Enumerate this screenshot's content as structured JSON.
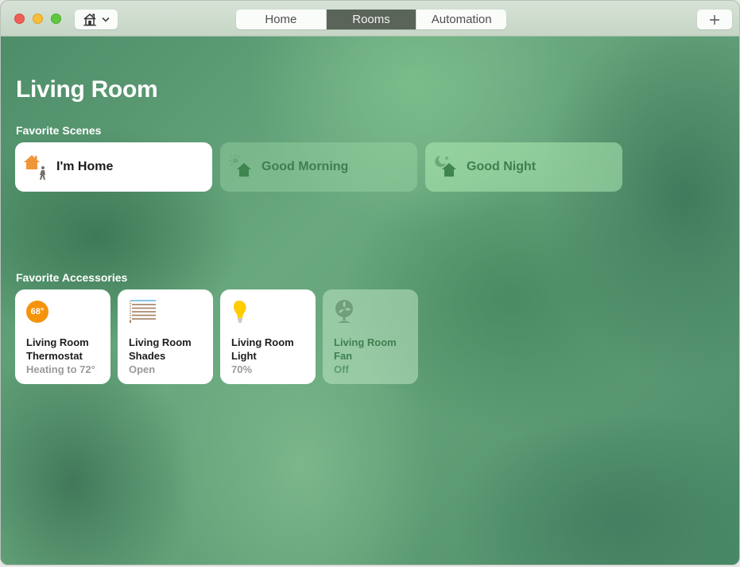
{
  "window": {
    "traffic_lights": [
      "close",
      "minimize",
      "maximize"
    ]
  },
  "toolbar": {
    "home_menu_icon": "house-icon",
    "home_menu_chevron": "chevron-down-icon",
    "tabs": [
      {
        "label": "Home",
        "active": false
      },
      {
        "label": "Rooms",
        "active": true
      },
      {
        "label": "Automation",
        "active": false
      }
    ],
    "add_button_icon": "plus-icon"
  },
  "room": {
    "title": "Living Room"
  },
  "scenes": {
    "label": "Favorite Scenes",
    "items": [
      {
        "label": "I'm Home",
        "icon": "home-arrival-icon",
        "active": true
      },
      {
        "label": "Good Morning",
        "icon": "morning-sun-house-icon",
        "active": false
      },
      {
        "label": "Good Night",
        "icon": "night-moon-house-icon",
        "active": false
      }
    ]
  },
  "accessories": {
    "label": "Favorite Accessories",
    "items": [
      {
        "name": "Living Room Thermostat",
        "status": "Heating to 72°",
        "badge": "68°",
        "icon": "thermostat-icon",
        "on": true
      },
      {
        "name": "Living Room Shades",
        "status": "Open",
        "icon": "window-shades-icon",
        "on": true
      },
      {
        "name": "Living Room Light",
        "status": "70%",
        "icon": "light-bulb-icon",
        "on": true
      },
      {
        "name": "Living Room Fan",
        "status": "Off",
        "icon": "fan-icon",
        "on": false
      }
    ]
  },
  "colors": {
    "thermostat_accent": "#f5930b",
    "light_accent": "#ffcc00",
    "scene_home_accent": "#f0963a",
    "selected_tab_bg": "#5a6459"
  }
}
